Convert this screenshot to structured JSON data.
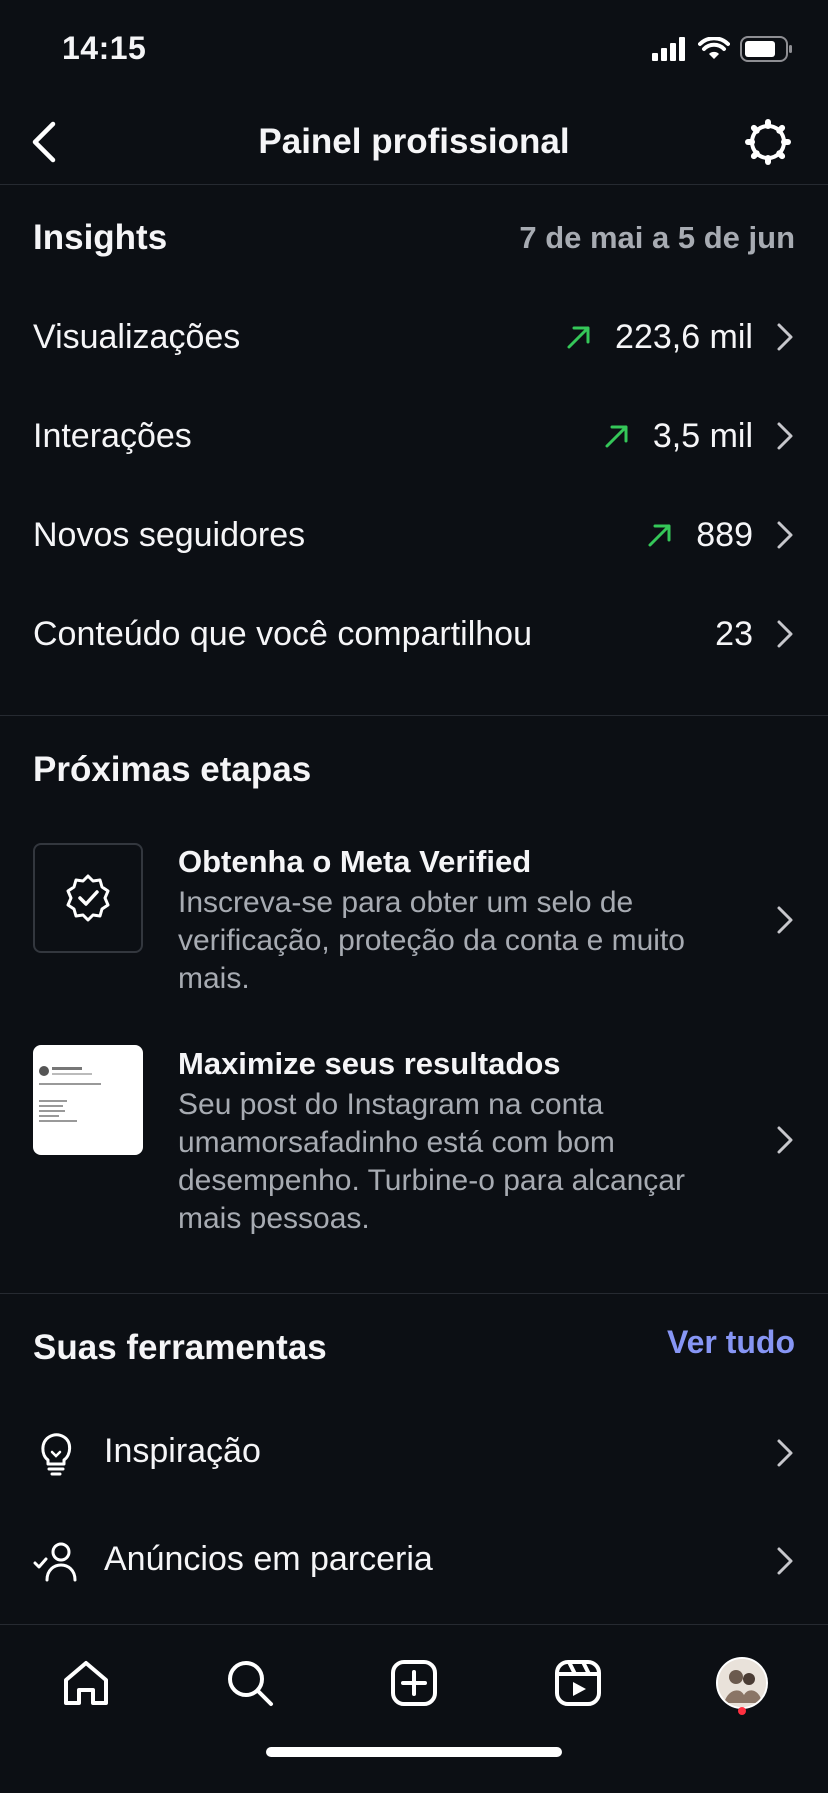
{
  "status": {
    "time": "14:15"
  },
  "header": {
    "title": "Painel profissional",
    "back_icon": "chevron-left-icon",
    "settings_icon": "gear-icon"
  },
  "insights": {
    "title": "Insights",
    "date_range": "7 de mai a 5 de jun",
    "trend_color": "#35c759",
    "rows": [
      {
        "label": "Visualizações",
        "value": "223,6 mil",
        "trend": "up"
      },
      {
        "label": "Interações",
        "value": "3,5 mil",
        "trend": "up"
      },
      {
        "label": "Novos seguidores",
        "value": "889",
        "trend": "up"
      },
      {
        "label": "Conteúdo que você compartilhou",
        "value": "23",
        "trend": "none"
      }
    ]
  },
  "next_steps": {
    "title": "Próximas etapas",
    "items": [
      {
        "title": "Obtenha o Meta Verified",
        "description": "Inscreva-se para obter um selo de verificação, proteção da conta e muito mais.",
        "icon": "verified-badge-icon"
      },
      {
        "title": "Maximize seus resultados",
        "description": "Seu post do Instagram na conta umamorsafadinho está com bom desempenho. Turbine-o para alcançar mais pessoas.",
        "icon": "post-thumbnail"
      }
    ]
  },
  "tools": {
    "title": "Suas ferramentas",
    "see_all": "Ver tudo",
    "accent": "#8796f5",
    "items": [
      {
        "label": "Inspiração",
        "icon": "lightbulb-icon"
      },
      {
        "label": "Anúncios em parceria",
        "icon": "partnership-user-icon"
      }
    ]
  },
  "tabbar": {
    "items": [
      "home-icon",
      "search-icon",
      "create-icon",
      "reels-icon",
      "profile-avatar"
    ]
  }
}
